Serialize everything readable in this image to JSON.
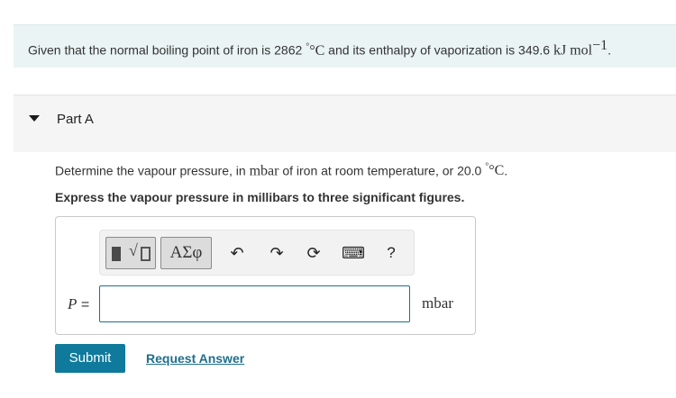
{
  "intro": {
    "text_before": "Given that the normal boiling point of iron is 2862 ",
    "boiling_unit": "°C",
    "text_middle": " and its enthalpy of vaporization is 349.6 ",
    "enthalpy_unit": "kJ mol",
    "enthalpy_exp": "−1",
    "text_end": "."
  },
  "part": {
    "title": "Part A"
  },
  "question": {
    "text_before": "Determine the vapour pressure, in ",
    "unit": "mbar",
    "text_middle": " of iron at room temperature, or 20.0 ",
    "temp_unit": "°C",
    "text_end": ".",
    "instruction": "Express the vapour pressure in millibars to three significant figures."
  },
  "toolbar": {
    "templates_icon": "templates-icon",
    "symbols_label": "ΑΣφ",
    "undo_icon": "↶",
    "redo_icon": "↷",
    "reset_icon": "⟳",
    "keyboard_icon": "⌨",
    "help_label": "?"
  },
  "answer": {
    "variable": "P",
    "equals": " =",
    "value": "",
    "unit": "mbar"
  },
  "actions": {
    "submit_label": "Submit",
    "request_label": "Request Answer"
  },
  "colors": {
    "intro_background": "#eaf4f5",
    "accent": "#0f7a9c",
    "link": "#1f6f8b"
  }
}
